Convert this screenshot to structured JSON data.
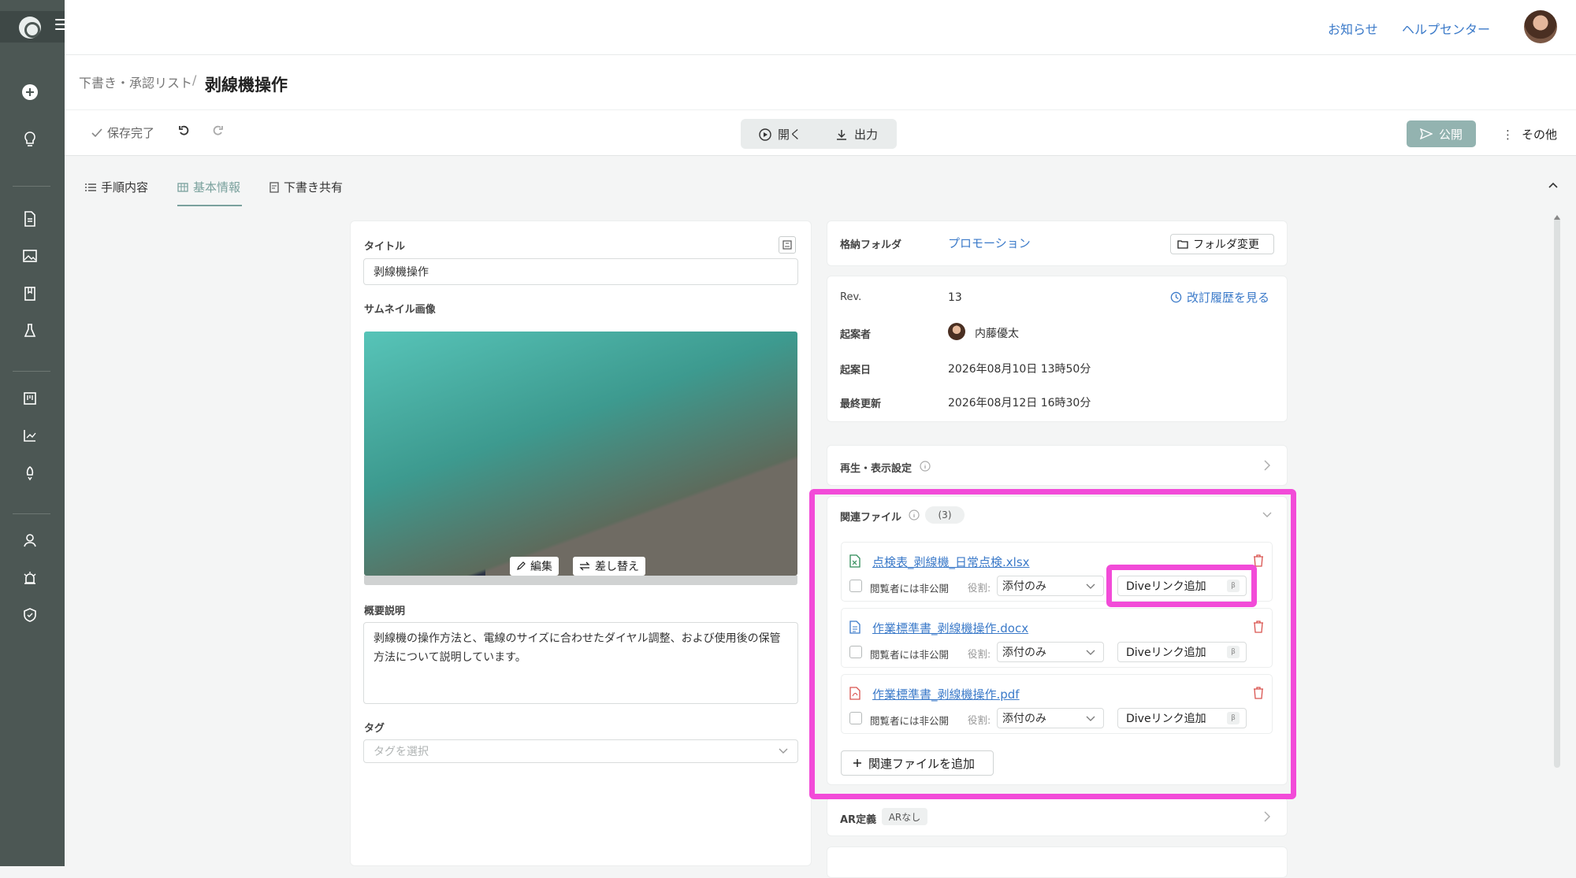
{
  "header": {
    "notifications": "お知らせ",
    "help_center": "ヘルプセンター"
  },
  "breadcrumb": {
    "parent": "下書き・承認リスト",
    "separator": "/",
    "title": "剥線機操作"
  },
  "toolbar": {
    "save_status": "保存完了",
    "open": "開く",
    "export": "出力",
    "publish": "公開",
    "more": "その他"
  },
  "tabs": [
    {
      "label": "手順内容"
    },
    {
      "label": "基本情報"
    },
    {
      "label": "下書き共有"
    }
  ],
  "basic": {
    "title_label": "タイトル",
    "title_value": "剥線機操作",
    "thumbnail_label": "サムネイル画像",
    "edit": "編集",
    "replace": "差し替え",
    "summary_label": "概要説明",
    "summary_value": "剥線機の操作方法と、電線のサイズに合わせたダイヤル調整、および使用後の保管方法について説明しています。",
    "tag_label": "タグ",
    "tag_placeholder": "タグを選択"
  },
  "folder": {
    "label": "格納フォルダ",
    "value": "プロモーション",
    "change": "フォルダ変更"
  },
  "meta": {
    "rev_label": "Rev.",
    "rev_value": "13",
    "history_link": "改訂履歴を見る",
    "author_label": "起案者",
    "author_value": "内藤優太",
    "created_label": "起案日",
    "created_value": "2026年08月10日 13時50分",
    "updated_label": "最終更新",
    "updated_value": "2026年08月12日 16時30分"
  },
  "playback": {
    "label": "再生・表示設定"
  },
  "related": {
    "label": "関連ファイル",
    "count": "(3)",
    "hide_label": "閲覧者には非公開",
    "role_label": "役割:",
    "dive_label": "Diveリンク追加",
    "beta": "β",
    "add_button": "関連ファイルを追加",
    "files": [
      {
        "name": "点検表_剥線機_日常点検.xlsx",
        "role": "添付のみ",
        "type": "xlsx",
        "color": "#2e8b57"
      },
      {
        "name": "作業標準書_剥線機操作.docx",
        "role": "添付のみ",
        "type": "docx",
        "color": "#3b7ac9"
      },
      {
        "name": "作業標準書_剥線機操作.pdf",
        "role": "添付のみ",
        "type": "pdf",
        "color": "#d9534f"
      }
    ]
  },
  "ar": {
    "label": "AR定義",
    "badge": "ARなし"
  },
  "colors": {
    "accent": "#7aa19d",
    "highlight": "#f24bd8",
    "link": "#3b7ac9",
    "sidebar": "#4c5754"
  }
}
